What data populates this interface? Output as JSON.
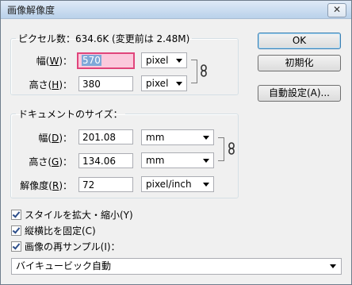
{
  "window": {
    "title": "画像解像度",
    "close_label": "✕"
  },
  "pixel_group": {
    "legend": "ピクセル数：634.6K (変更前は 2.48M)",
    "width": {
      "label": "幅(",
      "mnemonic": "W",
      "suffix": ")：",
      "value": "570",
      "unit": "pixel"
    },
    "height": {
      "label": "高さ(",
      "mnemonic": "H",
      "suffix": ")：",
      "value": "380",
      "unit": "pixel"
    }
  },
  "document_group": {
    "legend": "ドキュメントのサイズ：",
    "width": {
      "label": "幅(",
      "mnemonic": "D",
      "suffix": ")：",
      "value": "201.08",
      "unit": "mm"
    },
    "height": {
      "label": "高さ(",
      "mnemonic": "G",
      "suffix": ")：",
      "value": "134.06",
      "unit": "mm"
    },
    "resolution": {
      "label": "解像度(",
      "mnemonic": "R",
      "suffix": ")：",
      "value": "72",
      "unit": "pixel/inch"
    }
  },
  "buttons": {
    "ok": "OK",
    "reset": "初期化",
    "auto": "自動設定(A)..."
  },
  "options": {
    "scale_styles": {
      "label": "スタイルを拡大・縮小(Y)",
      "checked": true
    },
    "constrain": {
      "label": "縦横比を固定(C)",
      "checked": true
    },
    "resample": {
      "label": "画像の再サンプル(I)：",
      "checked": true
    }
  },
  "resample_method": "バイキュービック自動",
  "icons": {
    "chain": "chain-link-icon",
    "dropdown": "chevron-down-icon"
  }
}
